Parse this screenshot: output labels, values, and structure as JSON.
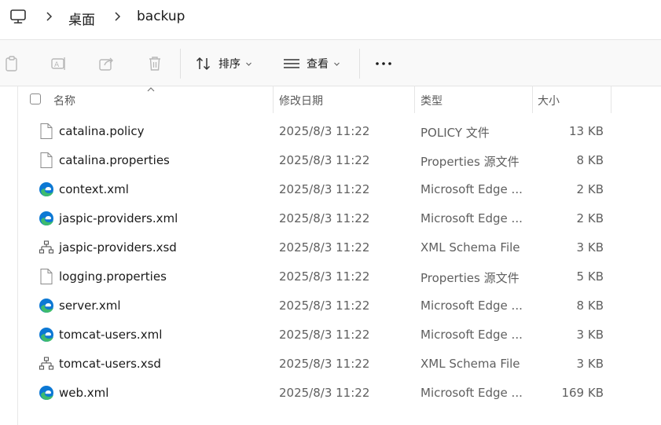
{
  "breadcrumb": {
    "items": [
      "桌面",
      "backup"
    ]
  },
  "toolbar": {
    "sort_label": "排序",
    "view_label": "查看",
    "more_label": "•••"
  },
  "columns": {
    "name": "名称",
    "date": "修改日期",
    "type": "类型",
    "size": "大小"
  },
  "files": [
    {
      "name": "catalina.policy",
      "date": "2025/8/3 11:22",
      "type": "POLICY 文件",
      "size": "13 KB",
      "icon": "document-icon"
    },
    {
      "name": "catalina.properties",
      "date": "2025/8/3 11:22",
      "type": "Properties 源文件",
      "size": "8 KB",
      "icon": "document-icon"
    },
    {
      "name": "context.xml",
      "date": "2025/8/3 11:22",
      "type": "Microsoft Edge ...",
      "size": "2 KB",
      "icon": "edge-icon"
    },
    {
      "name": "jaspic-providers.xml",
      "date": "2025/8/3 11:22",
      "type": "Microsoft Edge ...",
      "size": "2 KB",
      "icon": "edge-icon"
    },
    {
      "name": "jaspic-providers.xsd",
      "date": "2025/8/3 11:22",
      "type": "XML Schema File",
      "size": "3 KB",
      "icon": "schema-icon"
    },
    {
      "name": "logging.properties",
      "date": "2025/8/3 11:22",
      "type": "Properties 源文件",
      "size": "5 KB",
      "icon": "document-icon"
    },
    {
      "name": "server.xml",
      "date": "2025/8/3 11:22",
      "type": "Microsoft Edge ...",
      "size": "8 KB",
      "icon": "edge-icon"
    },
    {
      "name": "tomcat-users.xml",
      "date": "2025/8/3 11:22",
      "type": "Microsoft Edge ...",
      "size": "3 KB",
      "icon": "edge-icon"
    },
    {
      "name": "tomcat-users.xsd",
      "date": "2025/8/3 11:22",
      "type": "XML Schema File",
      "size": "3 KB",
      "icon": "schema-icon"
    },
    {
      "name": "web.xml",
      "date": "2025/8/3 11:22",
      "type": "Microsoft Edge ...",
      "size": "169 KB",
      "icon": "edge-icon"
    }
  ],
  "colors": {
    "edge_blue": "#0c78d4",
    "edge_green": "#3dbb6e",
    "toolbar_bg": "#f9f9f9"
  }
}
